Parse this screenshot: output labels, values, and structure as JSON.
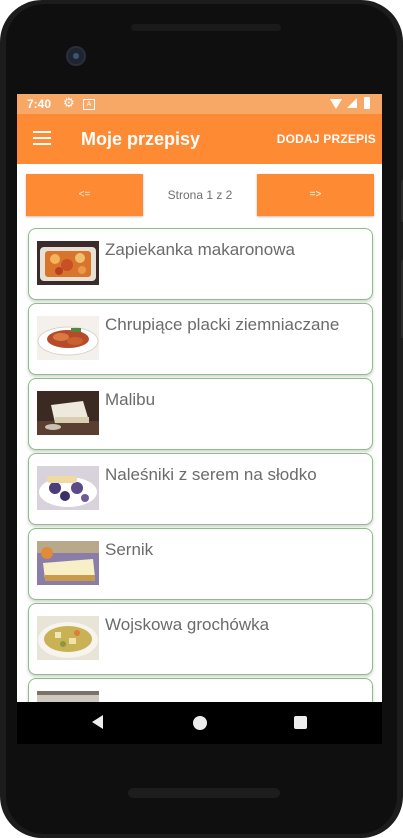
{
  "status_bar": {
    "time": "7:40",
    "icons": [
      "gear-icon",
      "android-notification-icon",
      "wifi-icon",
      "signal-icon",
      "battery-icon"
    ]
  },
  "app_bar": {
    "title": "Moje przepisy",
    "add_label": "DODAJ PRZEPIS",
    "menu_icon": "hamburger-menu-icon",
    "color": "#ff8a34"
  },
  "pager": {
    "prev_label": "<=",
    "next_label": "=>",
    "page_label": "Strona 1 z 2"
  },
  "recipes": [
    {
      "name": "Zapiekanka makaronowa",
      "thumb": "pasta-bake-photo"
    },
    {
      "name": "Chrupiące placki ziemniaczane",
      "thumb": "potato-pancakes-photo"
    },
    {
      "name": "Malibu",
      "thumb": "malibu-cake-photo"
    },
    {
      "name": "Naleśniki z serem na słodko",
      "thumb": "crepes-photo"
    },
    {
      "name": "Sernik",
      "thumb": "cheesecake-photo"
    },
    {
      "name": "Wojskowa grochówka",
      "thumb": "pea-soup-photo"
    },
    {
      "name": "",
      "thumb": "partially-visible-photo"
    }
  ],
  "nav_bar": {
    "buttons": [
      "back-icon",
      "home-icon",
      "recents-icon"
    ]
  },
  "colors": {
    "accent": "#ff8a34",
    "status_bar": "#f7a866",
    "card_border": "#8bbf85"
  }
}
